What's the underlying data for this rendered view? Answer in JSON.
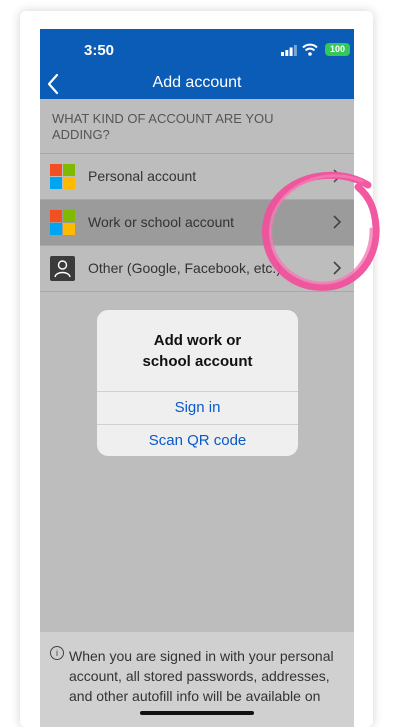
{
  "status_bar": {
    "time": "3:50",
    "battery": "100"
  },
  "nav": {
    "title": "Add account"
  },
  "prompt": "WHAT KIND OF ACCOUNT ARE YOU ADDING?",
  "accounts": [
    {
      "label": "Personal account",
      "icon": "microsoft-logo-icon"
    },
    {
      "label": "Work or school account",
      "icon": "microsoft-logo-icon",
      "selected": true
    },
    {
      "label": "Other (Google, Facebook, etc.)",
      "icon": "person-icon"
    }
  ],
  "dialog": {
    "title_line1": "Add work or",
    "title_line2": "school account",
    "sign_in": "Sign in",
    "scan_qr": "Scan QR code"
  },
  "footer": {
    "text": "When you are signed in with your personal account, all stored passwords, addresses, and other autofill info will be available on"
  },
  "colors": {
    "brand_blue": "#0b5cb7",
    "link_blue": "#0a58c9",
    "highlight_pink": "#f0509b",
    "battery_green": "#34c759"
  }
}
